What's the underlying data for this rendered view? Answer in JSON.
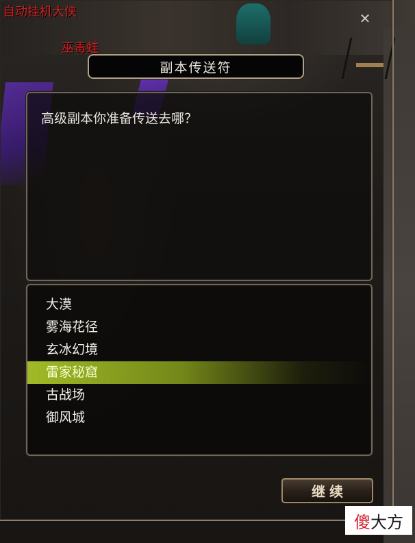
{
  "world": {
    "overhead_labels": [
      "自动挂机大侠",
      "巫毒蛙"
    ],
    "overhead_label_right": "巫毒蛙"
  },
  "dialog": {
    "title": "副本传送符",
    "close_icon": "close-icon",
    "question": "高级副本你准备传送去哪？",
    "options": [
      {
        "label": "大漠",
        "selected": false
      },
      {
        "label": "雾海花径",
        "selected": false
      },
      {
        "label": "玄冰幻境",
        "selected": false
      },
      {
        "label": "雷家秘窟",
        "selected": true
      },
      {
        "label": "古战场",
        "selected": false
      },
      {
        "label": "御风城",
        "selected": false
      }
    ],
    "continue_label": "继续",
    "selected_highlight_color": "#a8c428"
  },
  "watermark": {
    "first_char": "傻",
    "rest": "大方"
  }
}
